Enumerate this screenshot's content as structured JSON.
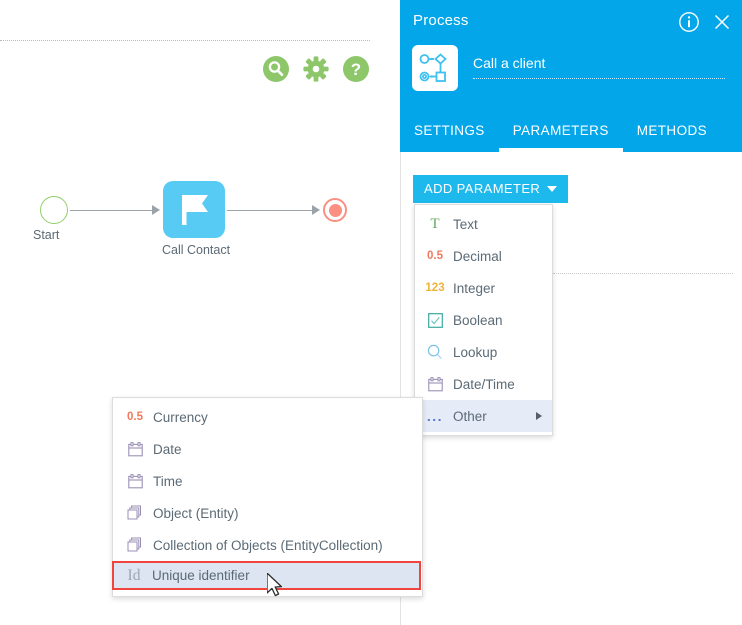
{
  "canvas": {
    "tools": [
      {
        "name": "search-icon",
        "label": "Search"
      },
      {
        "name": "gear-icon",
        "label": "Settings"
      },
      {
        "name": "help-icon",
        "label": "Help"
      }
    ],
    "diagram": {
      "start_label": "Start",
      "task_label": "Call Contact",
      "task_icon": "flag-icon",
      "end_label": ""
    },
    "colors": {
      "start_stroke": "#92cf6a",
      "task_fill": "#58cbf5",
      "end_stroke": "#fa8f82",
      "edge": "#9aa3aa",
      "tool_green": "#8dc76a"
    }
  },
  "panel": {
    "title": "Process",
    "entity_name": "Call a client",
    "entity_icon": "process-diagram-icon",
    "actions": [
      {
        "name": "info-icon",
        "label": "Info"
      },
      {
        "name": "close-icon",
        "label": "Close"
      }
    ],
    "tabs": [
      {
        "label": "SETTINGS",
        "active": false
      },
      {
        "label": "PARAMETERS",
        "active": true
      },
      {
        "label": "METHODS",
        "active": false
      }
    ],
    "add_parameter_label": "ADD PARAMETER",
    "colors": {
      "header_blue": "#04a6ea",
      "button_blue": "#1db8ec"
    }
  },
  "menu_main": {
    "items": [
      {
        "label": "Text",
        "icon": "text-T-icon",
        "icon_text": "T",
        "submenu": false
      },
      {
        "label": "Decimal",
        "icon": "decimal-icon",
        "icon_text": "0.5",
        "submenu": false
      },
      {
        "label": "Integer",
        "icon": "integer-icon",
        "icon_text": "123",
        "submenu": false
      },
      {
        "label": "Boolean",
        "icon": "checkbox-icon",
        "icon_text": "",
        "submenu": false
      },
      {
        "label": "Lookup",
        "icon": "magnifier-icon",
        "icon_text": "",
        "submenu": false
      },
      {
        "label": "Date/Time",
        "icon": "calendar-icon",
        "icon_text": "",
        "submenu": false
      },
      {
        "label": "Other",
        "icon": "ellipsis-icon",
        "icon_text": "...",
        "submenu": true
      }
    ]
  },
  "menu_sub": {
    "items": [
      {
        "label": "Currency",
        "icon": "decimal-icon",
        "icon_text": "0.5"
      },
      {
        "label": "Date",
        "icon": "calendar-icon",
        "icon_text": ""
      },
      {
        "label": "Time",
        "icon": "calendar-icon",
        "icon_text": ""
      },
      {
        "label": "Object (Entity)",
        "icon": "stacked-objects-icon",
        "icon_text": ""
      },
      {
        "label": "Collection of Objects (EntityCollection)",
        "icon": "stacked-objects-icon",
        "icon_text": ""
      }
    ],
    "highlighted_item": {
      "label": "Unique identifier",
      "icon": "id-icon",
      "icon_text": "Id"
    },
    "highlight_border_color": "#f0453f"
  }
}
